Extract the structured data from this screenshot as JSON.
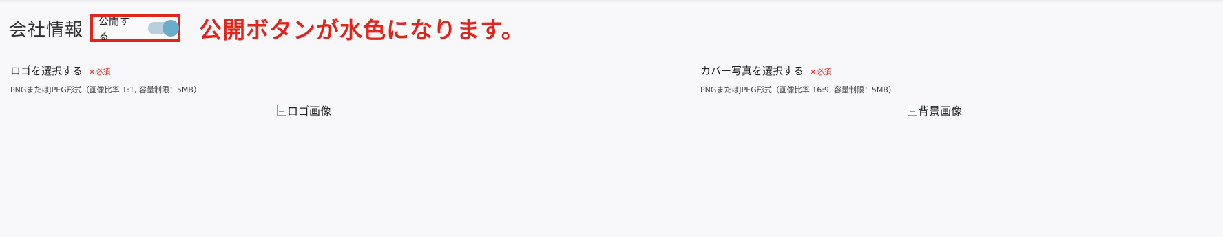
{
  "section": {
    "title": "会社情報"
  },
  "publish_toggle": {
    "label": "公開する",
    "state": "on",
    "on_color": "#6aaccc"
  },
  "annotation": {
    "text": "公開ボタンが水色になります。",
    "color": "#e0261c"
  },
  "logo_upload": {
    "label": "ロゴを選択する",
    "required": "※必須",
    "hint": "PNGまたはJPEG形式（画像比率 1:1, 容量制限：5MB）",
    "image_alt": "ロゴ画像"
  },
  "cover_upload": {
    "label": "カバー写真を選択する",
    "required": "※必須",
    "hint": "PNGまたはJPEG形式（画像比率 16:9, 容量制限：5MB）",
    "image_alt": "背景画像"
  }
}
